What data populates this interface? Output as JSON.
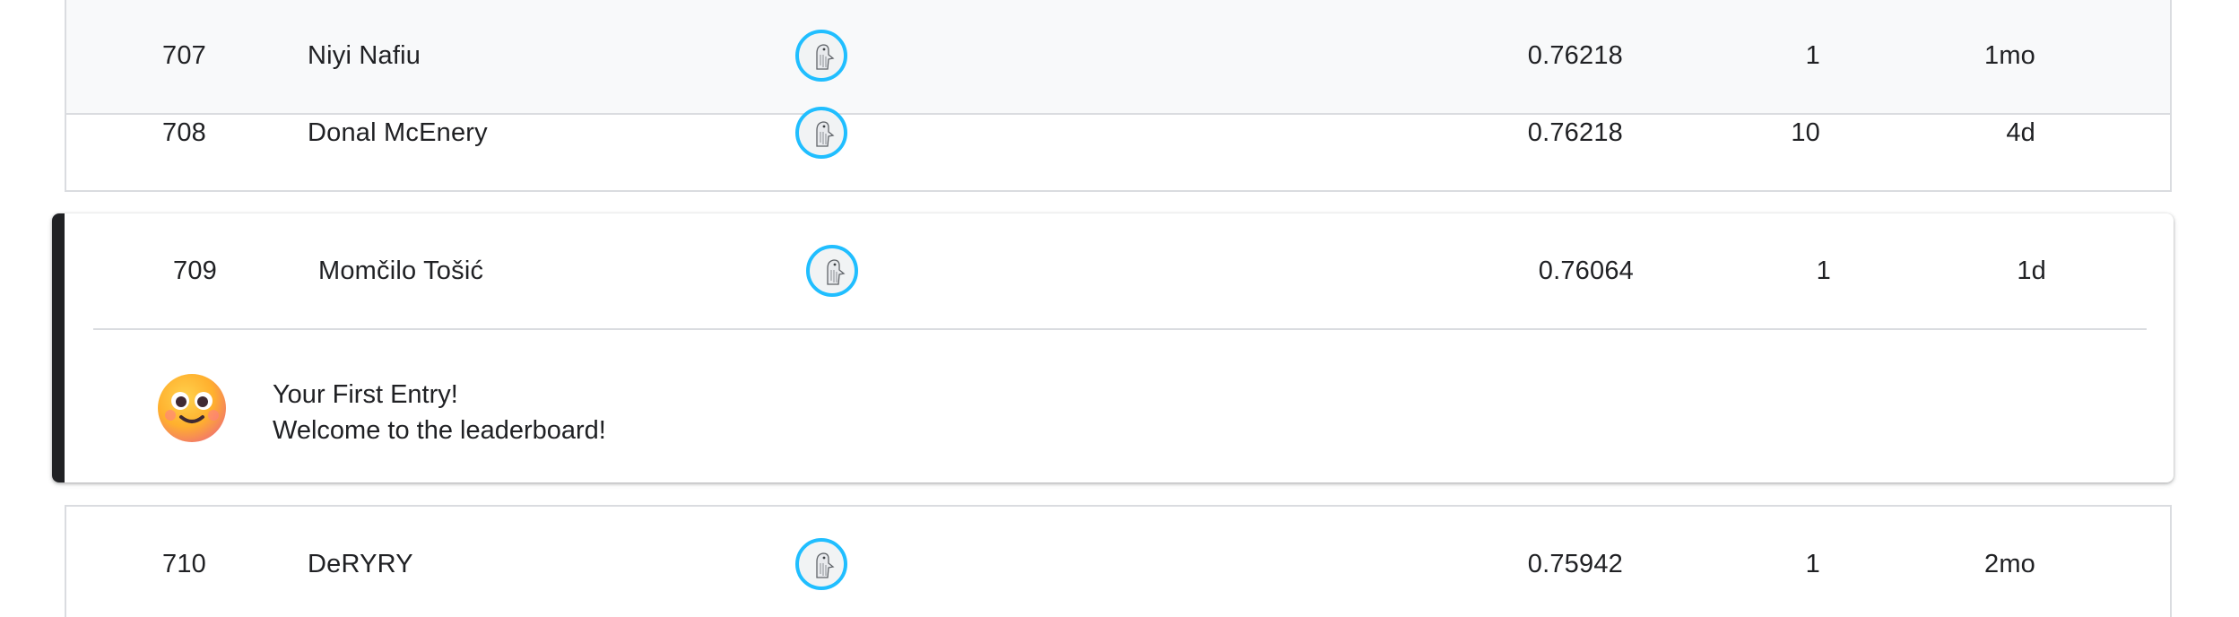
{
  "leaderboard": {
    "rows_top": [
      {
        "rank": "707",
        "name": "Niyi Nafiu",
        "score": "0.76218",
        "entries": "1",
        "last": "1mo"
      },
      {
        "rank": "708",
        "name": "Donal McEnery",
        "score": "0.76218",
        "entries": "10",
        "last": "4d"
      }
    ],
    "you_row": {
      "rank": "709",
      "name": "Momčilo Tošić",
      "score": "0.76064",
      "entries": "1",
      "last": "1d"
    },
    "you_badge": {
      "title": "Your First Entry!",
      "message": "Welcome to the leaderboard!",
      "icon": "smiling-face-emoji"
    },
    "rows_bottom": [
      {
        "rank": "710",
        "name": "DeRYRY",
        "score": "0.75942",
        "entries": "1",
        "last": "2mo"
      }
    ]
  },
  "colors": {
    "avatar_ring": "#20beff",
    "accent_bar": "#202124",
    "hover_row": "#f8f9fa",
    "divider": "#dadce0"
  }
}
